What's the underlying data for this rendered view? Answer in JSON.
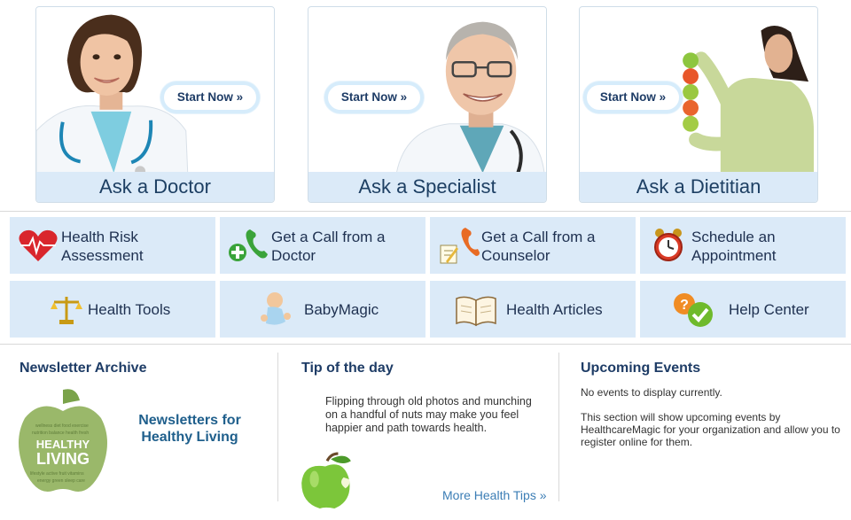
{
  "cards": [
    {
      "title": "Ask a Doctor",
      "button": "Start Now »"
    },
    {
      "title": "Ask a Specialist",
      "button": "Start Now »"
    },
    {
      "title": "Ask a Dietitian",
      "button": "Start Now »"
    }
  ],
  "services": [
    {
      "label": "Health Risk Assessment",
      "icon": "heart-ecg-icon"
    },
    {
      "label": "Get a Call from a Doctor",
      "icon": "phone-plus-icon"
    },
    {
      "label": "Get a Call from a Counselor",
      "icon": "phone-notepad-icon"
    },
    {
      "label": "Schedule an Appointment",
      "icon": "alarm-clock-icon"
    },
    {
      "label": "Health Tools",
      "icon": "scales-icon"
    },
    {
      "label": "BabyMagic",
      "icon": "baby-icon"
    },
    {
      "label": "Health Articles",
      "icon": "open-book-icon"
    },
    {
      "label": "Help Center",
      "icon": "question-check-icon"
    }
  ],
  "newsletter": {
    "title": "Newsletter Archive",
    "link": "Newsletters for Healthy Living",
    "apple_text": "HEALTHY LIVING"
  },
  "tip": {
    "title": "Tip of the day",
    "text": "Flipping through old photos and munching on a handful of nuts may make you feel happier and path towards health.",
    "more": "More Health Tips »"
  },
  "events": {
    "title": "Upcoming Events",
    "none": "No events to display currently.",
    "description": "This section will show upcoming events by HealthcareMagic for your organization and allow you to register online for them."
  }
}
